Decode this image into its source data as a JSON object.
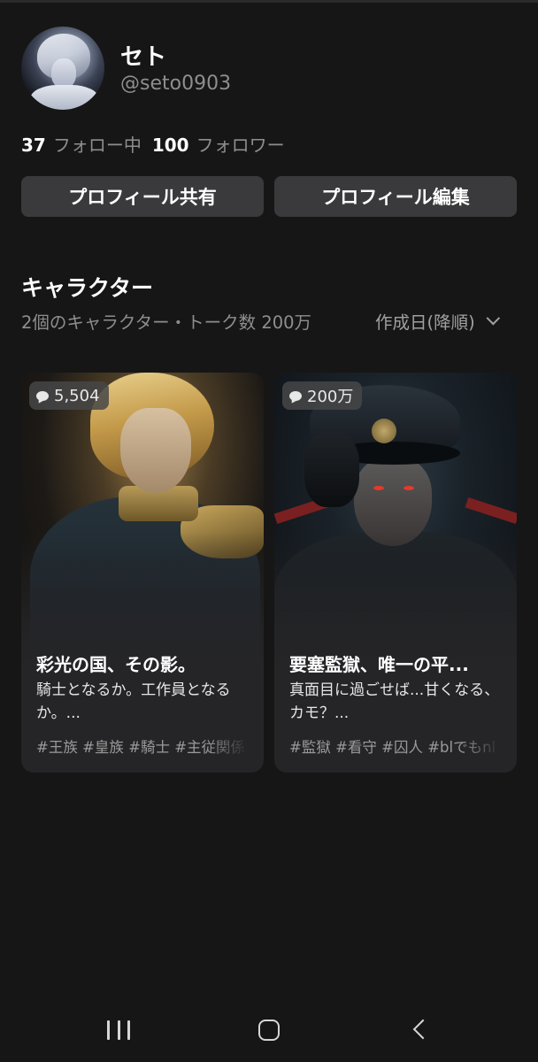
{
  "profile": {
    "display_name": "セト",
    "handle": "@seto0903",
    "following_count": "37",
    "following_label": "フォロー中",
    "followers_count": "100",
    "followers_label": "フォロワー"
  },
  "actions": {
    "share_label": "プロフィール共有",
    "edit_label": "プロフィール編集"
  },
  "characters_section": {
    "title": "キャラクター",
    "summary": "2個のキャラクター・トーク数 200万",
    "sort_label": "作成日(降順)"
  },
  "cards": [
    {
      "talk_count": "5,504",
      "title": "彩光の国、その影。",
      "description": "騎士となるか。工作員となるか。...",
      "tags": "#王族 #皇族 #騎士 #主従関係"
    },
    {
      "talk_count": "200万",
      "title": "要塞監獄、唯一の平...",
      "description": "真面目に過ごせば...甘くなる、カモ？...",
      "tags": "#監獄 #看守 #囚人 #blでもnl"
    }
  ],
  "nav": {
    "icons": [
      "recents-icon",
      "home-icon",
      "back-icon"
    ]
  },
  "colors": {
    "background": "#161616",
    "button": "#3a3a3c",
    "card": "#252527",
    "muted_text": "#8e8e8e"
  }
}
